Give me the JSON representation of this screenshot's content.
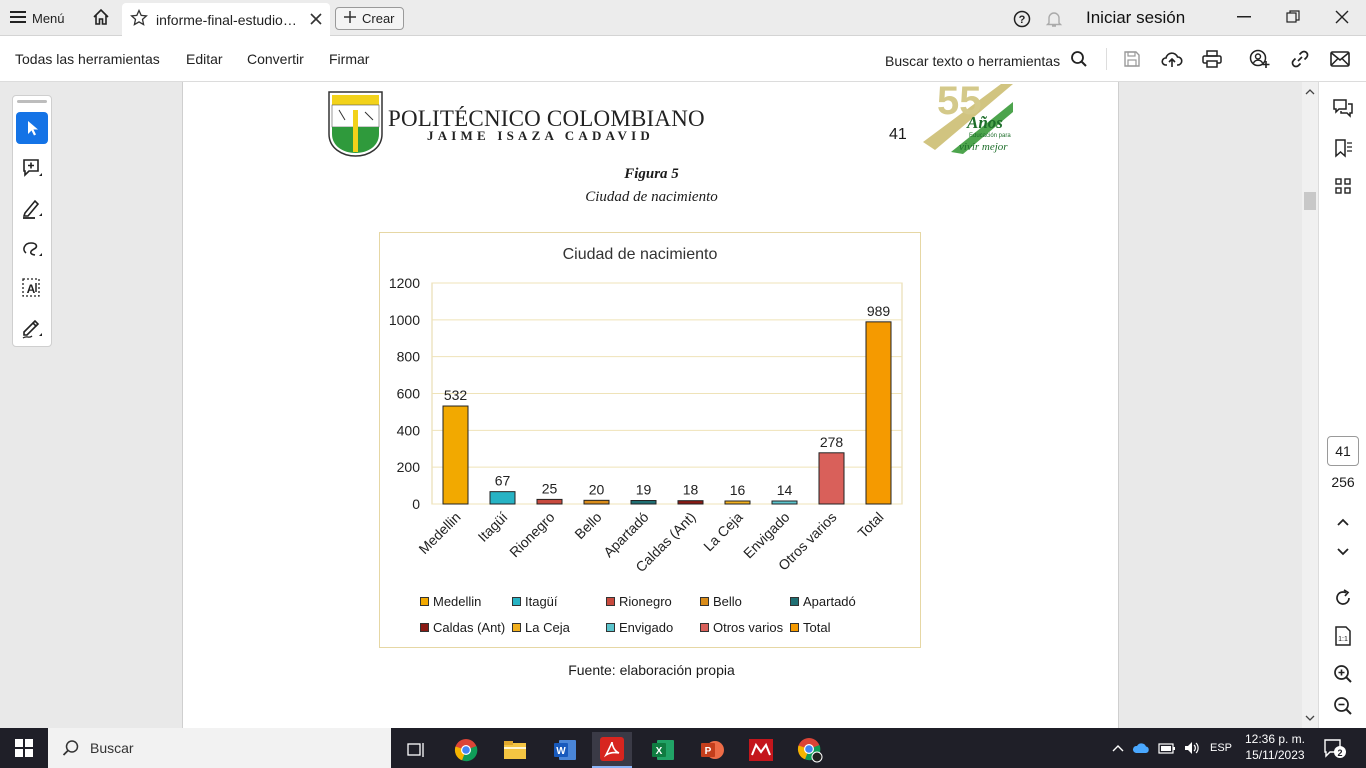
{
  "titlebar": {
    "menu_label": "Menú",
    "tab_title": "informe-final-estudio…",
    "create_label": "Crear",
    "signin_label": "Iniciar sesión"
  },
  "toolbar": {
    "items": [
      "Todas las herramientas",
      "Editar",
      "Convertir",
      "Firmar"
    ],
    "search_label": "Buscar texto o herramientas"
  },
  "document": {
    "institution_name": "POLITÉCNICO COLOMBIANO",
    "institution_subtitle": "JAIME ISAZA CADAVID",
    "page_number": "41",
    "anniversary_number": "55",
    "anniversary_word": "Años",
    "anniversary_tag_small": "Educación para",
    "anniversary_tag": "vivir mejor",
    "shield_label": "DESARROLLO Y TECNOLOGÍA",
    "figure_number": "Figura 5",
    "figure_caption": "Ciudad de nacimiento",
    "source_text": "Fuente: elaboración propia"
  },
  "navigation": {
    "current_page": "41",
    "total_pages": "256"
  },
  "taskbar": {
    "search_label": "Buscar",
    "language": "ESP",
    "time": "12:36 p. m.",
    "date": "15/11/2023",
    "notification_count": "2"
  },
  "colors": {
    "accent_blue": "#1473e6",
    "bar_orange": "#f59a00",
    "bar_teal": "#27b3c4",
    "bar_red": "#c84a3e",
    "bar_dark_teal": "#1f6f73",
    "bar_dark_red": "#8a1a14",
    "bar_salmon": "#d9605a",
    "bar_amber": "#f2a900",
    "light_teal": "#5bc4cc",
    "chart_border": "#e6d7a4"
  },
  "chart_data": {
    "type": "bar",
    "title": "Ciudad de nacimiento",
    "categories": [
      "Medellin",
      "Itagüí",
      "Rionegro",
      "Bello",
      "Apartadó",
      "Caldas (Ant)",
      "La Ceja",
      "Envigado",
      "Otros varios",
      "Total"
    ],
    "values": [
      532,
      67,
      25,
      20,
      19,
      18,
      16,
      14,
      278,
      989
    ],
    "colors": [
      "#f2a900",
      "#27b3c4",
      "#c84a3e",
      "#d98c1a",
      "#1f6f73",
      "#8a1a14",
      "#f2b01e",
      "#5bc4cc",
      "#d9605a",
      "#f59a00"
    ],
    "ylim": [
      0,
      1200
    ],
    "yticks": [
      0,
      200,
      400,
      600,
      800,
      1000,
      1200
    ],
    "grid": true,
    "legend_position": "bottom",
    "data_labels": true
  }
}
